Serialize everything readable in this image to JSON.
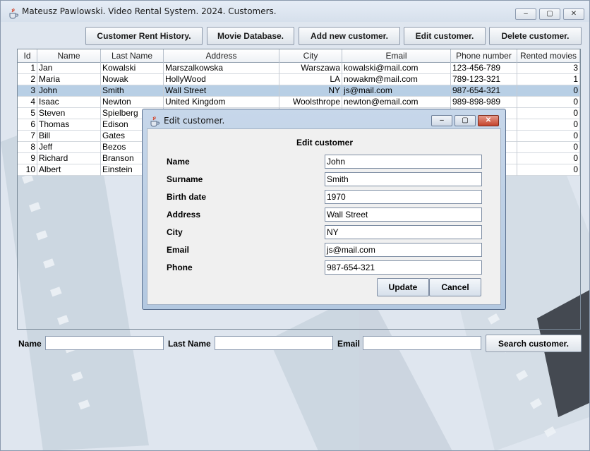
{
  "window": {
    "title": "Mateusz Pawlowski. Video Rental System. 2024. Customers.",
    "minimize": "–",
    "maximize": "▢",
    "close": "✕"
  },
  "toolbar": {
    "rent_history": "Customer Rent History.",
    "movie_db": "Movie Database.",
    "add_customer": "Add new customer.",
    "edit_customer": "Edit customer.",
    "delete_customer": "Delete customer."
  },
  "table": {
    "columns": [
      "Id",
      "Name",
      "Last Name",
      "Address",
      "City",
      "Email",
      "Phone number",
      "Rented movies"
    ],
    "rows": [
      {
        "id": "1",
        "name": "Jan",
        "last": "Kowalski",
        "address": "Marszalkowska",
        "city": "Warszawa",
        "email": "kowalski@mail.com",
        "phone": "123-456-789",
        "rented": "3"
      },
      {
        "id": "2",
        "name": "Maria",
        "last": "Nowak",
        "address": "HollyWood",
        "city": "LA",
        "email": "nowakm@mail.com",
        "phone": "789-123-321",
        "rented": "1"
      },
      {
        "id": "3",
        "name": "John",
        "last": "Smith",
        "address": "Wall Street",
        "city": "NY",
        "email": "js@mail.com",
        "phone": "987-654-321",
        "rented": "0"
      },
      {
        "id": "4",
        "name": "Isaac",
        "last": "Newton",
        "address": "United Kingdom",
        "city": "Woolsthrope",
        "email": "newton@email.com",
        "phone": "989-898-989",
        "rented": "0"
      },
      {
        "id": "5",
        "name": "Steven",
        "last": "Spielberg",
        "address": "",
        "city": "",
        "email": "",
        "phone": "",
        "rented": "0"
      },
      {
        "id": "6",
        "name": "Thomas",
        "last": "Edison",
        "address": "",
        "city": "",
        "email": "",
        "phone": "",
        "rented": "0"
      },
      {
        "id": "7",
        "name": "Bill",
        "last": "Gates",
        "address": "",
        "city": "",
        "email": "",
        "phone": "",
        "rented": "0"
      },
      {
        "id": "8",
        "name": "Jeff",
        "last": "Bezos",
        "address": "",
        "city": "",
        "email": "",
        "phone": "",
        "rented": "0"
      },
      {
        "id": "9",
        "name": "Richard",
        "last": "Branson",
        "address": "",
        "city": "",
        "email": "",
        "phone": "",
        "rented": "0"
      },
      {
        "id": "10",
        "name": "Albert",
        "last": "Einstein",
        "address": "",
        "city": "",
        "email": "",
        "phone": "",
        "rented": "0"
      }
    ],
    "selected_id": "3"
  },
  "search": {
    "name_label": "Name",
    "last_name_label": "Last Name",
    "email_label": "Email",
    "name_value": "",
    "last_name_value": "",
    "email_value": "",
    "button": "Search customer."
  },
  "dialog": {
    "title": "Edit customer.",
    "heading": "Edit customer",
    "fields": [
      {
        "label": "Name",
        "value": "John"
      },
      {
        "label": "Surname",
        "value": "Smith"
      },
      {
        "label": "Birth date",
        "value": "1970"
      },
      {
        "label": "Address",
        "value": "Wall Street"
      },
      {
        "label": "City",
        "value": "NY"
      },
      {
        "label": "Email",
        "value": "js@mail.com"
      },
      {
        "label": "Phone",
        "value": "987-654-321"
      }
    ],
    "update": "Update",
    "cancel": "Cancel",
    "minimize": "–",
    "maximize": "▢",
    "close": "✕"
  },
  "icons": {
    "app_icon": "java-cup-icon",
    "background": "film-reel-watermark"
  },
  "colors": {
    "selection": "#b8cfe5",
    "dialog_frame": "#b3c8e0",
    "close_button": "#c4442d"
  }
}
